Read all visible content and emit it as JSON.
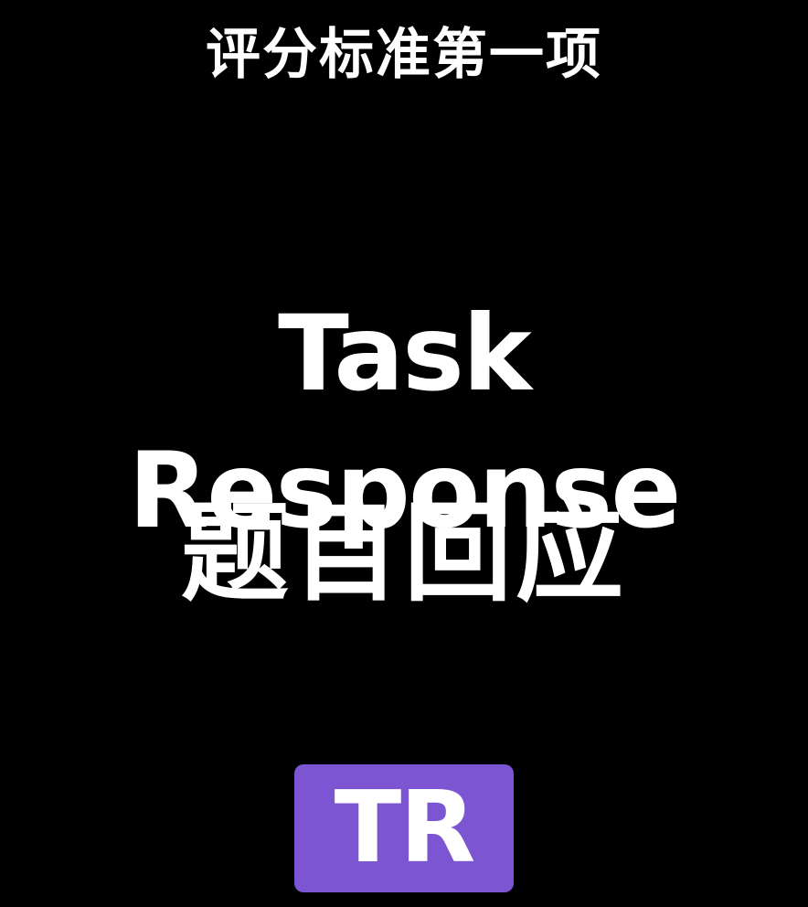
{
  "heading": "评分标准第一项",
  "term_english": "Task Response",
  "term_chinese": "题目回应",
  "badge": {
    "label": "TR",
    "color": "#7b55d2"
  },
  "colors": {
    "background": "#000000",
    "text": "#ffffff"
  }
}
